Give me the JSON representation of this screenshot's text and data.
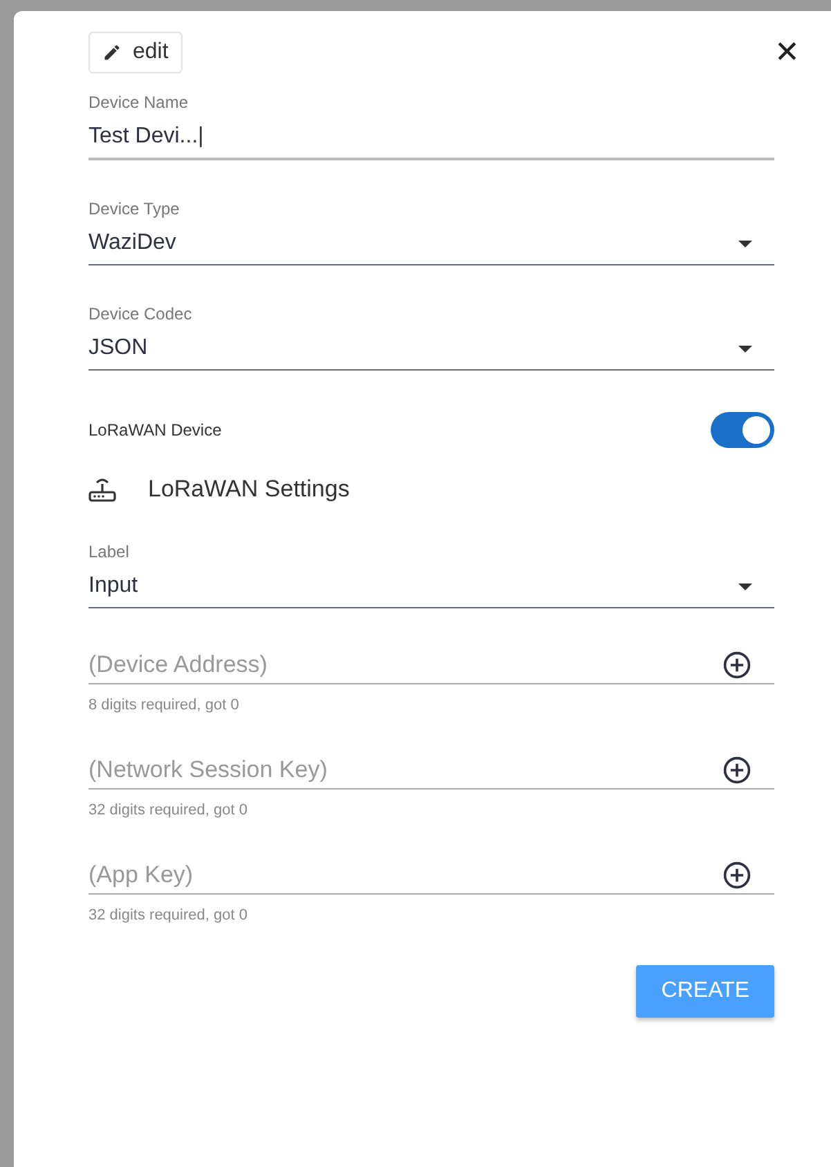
{
  "edit_button": {
    "label": "edit"
  },
  "close_button": {
    "label": "✕"
  },
  "fields": [
    {
      "kind": "text",
      "label": "Device Name",
      "value": "Test Devi...|"
    },
    {
      "kind": "select",
      "label": "Device Type",
      "value": "WaziDev"
    },
    {
      "kind": "select",
      "label": "Device Codec",
      "value": "JSON"
    }
  ],
  "lorawan_toggle": {
    "label": "LoRaWAN Device",
    "on": true
  },
  "lorawan_settings": {
    "title": "LoRaWAN Settings"
  },
  "lorawan_fields": [
    {
      "kind": "select",
      "label": "Label",
      "value": "Input"
    },
    {
      "kind": "key",
      "placeholder": "(Device Address)",
      "hint": "8 digits required, got 0"
    },
    {
      "kind": "key",
      "placeholder": "(Network Session Key)",
      "hint": "32 digits required, got 0"
    },
    {
      "kind": "key",
      "placeholder": "(App Key)",
      "hint": "32 digits required, got 0"
    }
  ],
  "create_button": {
    "label": "CREATE"
  }
}
